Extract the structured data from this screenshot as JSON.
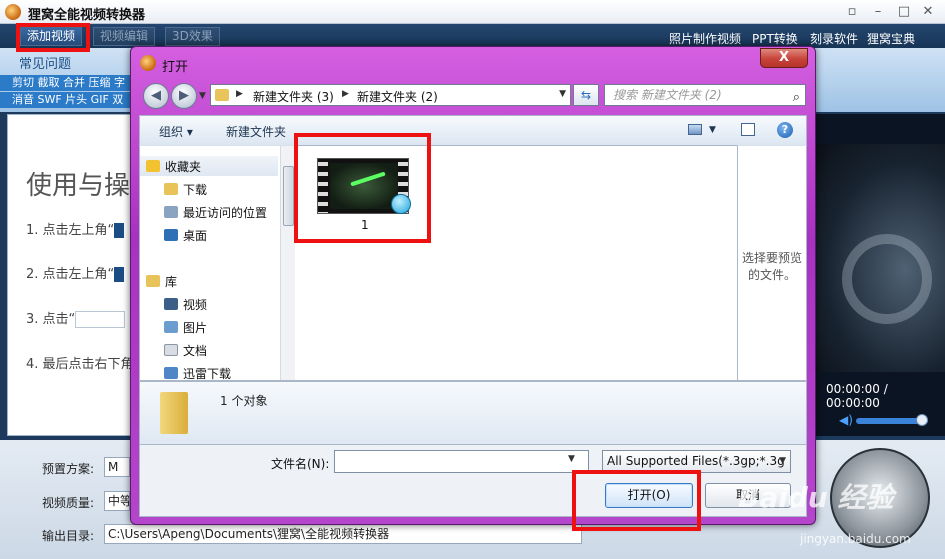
{
  "app": {
    "title": "狸窝全能视频转换器",
    "toolbar": {
      "add_video": "添加视频",
      "video_edit": "视频编辑",
      "effect_3d": "3D效果"
    },
    "top_links": [
      "照片制作视频",
      "PPT转换",
      "刻录软件",
      "狸窝宝典"
    ],
    "faq": {
      "title": "常见问题",
      "row1": "剪切 截取 合并 压缩 字",
      "row2": "消音 SWF 片头 GIF 双"
    },
    "guide": {
      "title": "使用与操",
      "step1": "1. 点击左上角“",
      "step2": "2. 点击左上角“",
      "step3": "3. 点击“",
      "step4": "4. 最后点击右下角"
    },
    "time_readout": "00:00:00 / 00:00:00",
    "bottom": {
      "preset_label": "预置方案:",
      "preset_value": "M",
      "quality_label": "视频质量:",
      "quality_value": "中等",
      "output_label": "输出目录:",
      "output_value": "C:\\Users\\Apeng\\Documents\\狸窝\\全能视频转换器"
    }
  },
  "dialog": {
    "title": "打开",
    "close": "X",
    "address": {
      "segment1": "新建文件夹 (3)",
      "segment2": "新建文件夹 (2)"
    },
    "search_placeholder": "搜索 新建文件夹 (2)",
    "toolbar": {
      "organize": "组织 ▾",
      "new_folder": "新建文件夹",
      "help": "?"
    },
    "nav": {
      "favorites": "收藏夹",
      "downloads": "下载",
      "recent": "最近访问的位置",
      "desktop": "桌面",
      "library": "库",
      "videos": "视频",
      "pictures": "图片",
      "documents": "文档",
      "thunder": "迅雷下载"
    },
    "file": {
      "name": "1"
    },
    "preview_hint_line1": "选择要预览",
    "preview_hint_line2": "的文件。",
    "details_count": "1 个对象",
    "filename_label": "文件名(N):",
    "filename_value": "",
    "filter_value": "All Supported Files(*.3gp;*.3g",
    "open_button": "打开(O)",
    "cancel_button": "取消"
  },
  "watermark": {
    "brand": "Baidu 经验",
    "url": "jingyan.baidu.com"
  },
  "colors": {
    "dialog_frame": "#b446cb",
    "annotation_red": "#ee1111",
    "app_header": "#173556"
  }
}
